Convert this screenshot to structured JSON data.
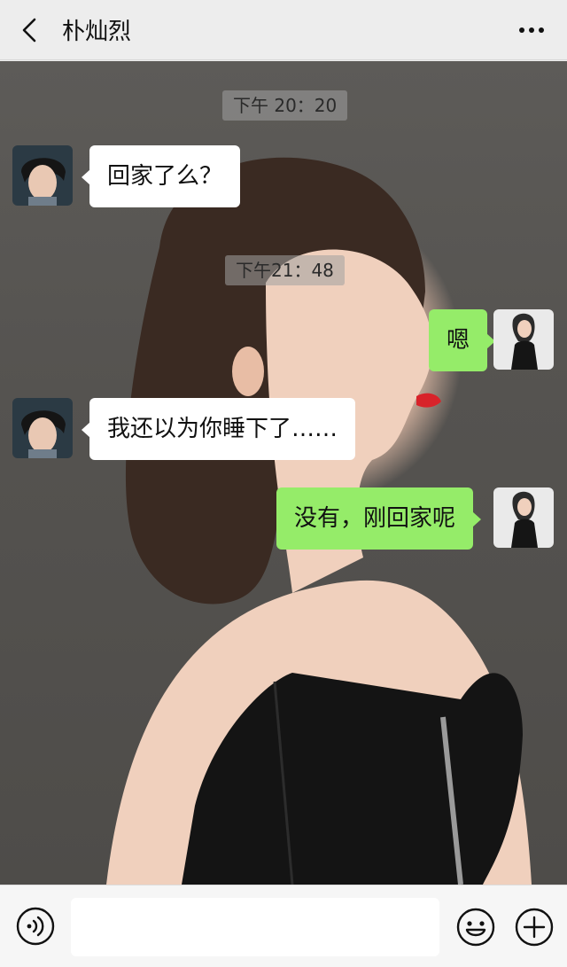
{
  "header": {
    "title": "朴灿烈",
    "back_icon": "chevron-left-icon",
    "more_icon": "more-dots-icon"
  },
  "messages": [
    {
      "type": "time",
      "text": "下午 20：20"
    },
    {
      "type": "msg",
      "side": "left",
      "text": "回家了么？"
    },
    {
      "type": "time",
      "text": "下午21：48"
    },
    {
      "type": "msg",
      "side": "right",
      "text": "嗯"
    },
    {
      "type": "msg",
      "side": "left",
      "text": "我还以为你睡下了……"
    },
    {
      "type": "msg",
      "side": "right",
      "text": "没有，刚回家呢"
    }
  ],
  "input": {
    "value": "",
    "voice_icon": "voice-icon",
    "emoji_icon": "emoji-icon",
    "plus_icon": "plus-icon"
  },
  "colors": {
    "header_bg": "#ededed",
    "bubble_left": "#ffffff",
    "bubble_right": "#95ec69"
  }
}
